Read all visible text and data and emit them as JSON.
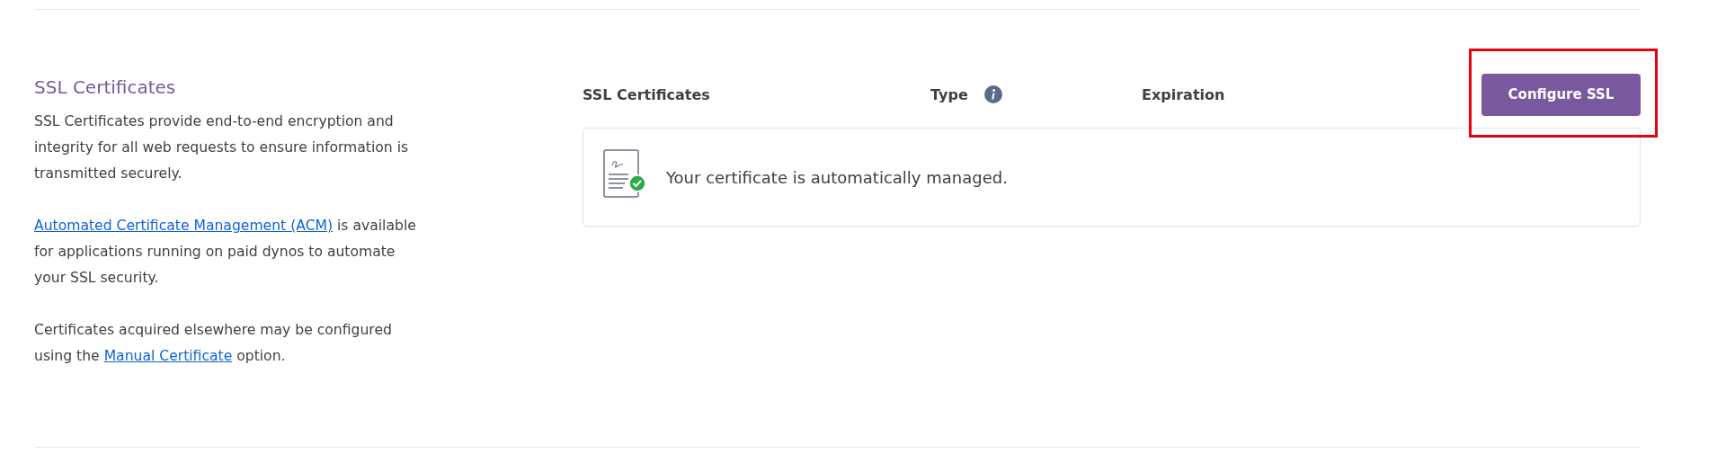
{
  "section": {
    "title": "SSL Certificates",
    "paragraphs": [
      [
        {
          "kind": "text",
          "text": "SSL Certificates provide end-to-end encryption and integrity for all web requests to ensure information is transmitted securely."
        }
      ],
      [
        {
          "kind": "link",
          "text": "Automated Certificate Management (ACM)"
        },
        {
          "kind": "text",
          "text": " is available for applications running on paid dynos to automate your SSL security."
        }
      ],
      [
        {
          "kind": "text",
          "text": "Certificates acquired elsewhere may be configured using the "
        },
        {
          "kind": "link",
          "text": "Manual Certificate"
        },
        {
          "kind": "text",
          "text": " option."
        }
      ]
    ]
  },
  "table": {
    "columns": [
      {
        "label": "SSL Certificates",
        "info": false
      },
      {
        "label": "Type",
        "info": true
      },
      {
        "label": "Expiration",
        "info": false
      }
    ],
    "configure_button": {
      "label": "Configure SSL",
      "highlighted": true
    },
    "message": "Your certificate is automatically managed."
  }
}
